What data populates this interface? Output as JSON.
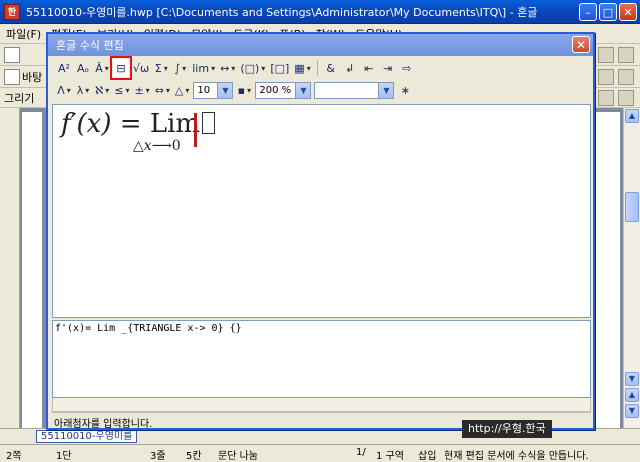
{
  "window": {
    "title": "55110010-우영미를.hwp [C:\\Documents and Settings\\Administrator\\My Documents\\ITQ\\] - 혼글",
    "app_icon": "hwp-icon"
  },
  "menubar": [
    "파일(F)",
    "편집(E)",
    "보기(U)",
    "입력(D)",
    "모양(J)",
    "도구(K)",
    "표(B)",
    "창(W)",
    "도움말(H)"
  ],
  "bg_toolbars": {
    "row2_label": "바탕",
    "row3_label": "그리기"
  },
  "dialog": {
    "title": "혼글 수식 편집",
    "font_size": "10",
    "zoom": "200 %",
    "font_combo": "",
    "script": "f'(x)= Lim _{TRIANGLE x-> 0} {}",
    "status": "아래첨자를 입력합니다.",
    "formula": {
      "func": "f′",
      "arg": "(x)",
      "eq": "=",
      "op": "Lim",
      "sub_delta": "△",
      "sub_var": "x",
      "sub_arrow": "⟶",
      "sub_val": "0"
    },
    "tool_row1": [
      "A²",
      "Aₒ",
      "Ǎ",
      "⊟",
      "√ω",
      "Σ",
      "∫",
      "lim",
      "↔",
      "(□)",
      "[□]",
      "▦",
      "&",
      "↲",
      "⇤",
      "⇥",
      "⇨"
    ],
    "tool_row2": [
      "Λ",
      "λ",
      "ℵ",
      "≤",
      "±",
      "⇔",
      "△",
      "▪",
      "∗"
    ]
  },
  "doc_tab": "55110010-우영미를",
  "watermark": "http://우형.한국",
  "statusbar": {
    "page": "2쪽",
    "section": "1단",
    "line": "3줄",
    "col": "5칸",
    "mode": "문단 나눔",
    "pages": "1/",
    "area": "1 구역",
    "insert": "삽입",
    "message": "현재 편집 문서에 수식을 만듭니다."
  }
}
